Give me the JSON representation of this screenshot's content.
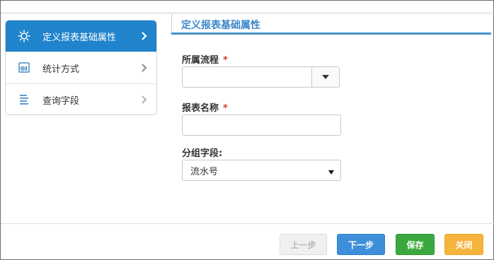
{
  "sidebar": {
    "items": [
      {
        "label": "定义报表基础属性",
        "icon": "gear-icon",
        "active": true
      },
      {
        "label": "统计方式",
        "icon": "chart-icon",
        "active": false
      },
      {
        "label": "查询字段",
        "icon": "list-icon",
        "active": false
      }
    ]
  },
  "main": {
    "section_title": "定义报表基础属性",
    "fields": {
      "process": {
        "label": "所属流程",
        "required_mark": "*",
        "value": ""
      },
      "report_name": {
        "label": "报表名称",
        "required_mark": "*",
        "value": ""
      },
      "group_field": {
        "label": "分组字段:",
        "value": "流水号"
      }
    }
  },
  "footer": {
    "prev_label": "上一步",
    "next_label": "下一步",
    "save_label": "保存",
    "close_label": "关闭"
  },
  "colors": {
    "accent": "#1f84cc",
    "title_blue": "#3a87c8",
    "required_red": "#d9342b",
    "next_blue": "#3d8fd9",
    "save_green": "#3ba83f",
    "close_orange": "#f7b43c"
  }
}
